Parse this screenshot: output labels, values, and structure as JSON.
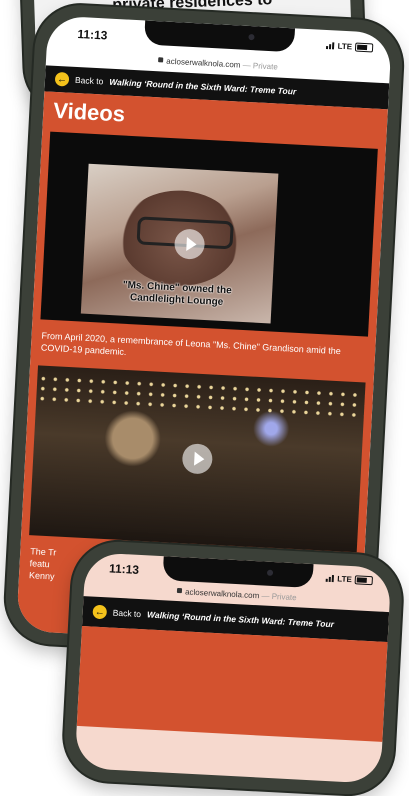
{
  "top_phone": {
    "partial_text": "private residences to",
    "back_chevron": "<"
  },
  "main_phone": {
    "status": {
      "time": "11:13",
      "network": "LTE"
    },
    "url": {
      "domain": "acloserwalknola.com",
      "separator": " — ",
      "private": "Private"
    },
    "back_bar": {
      "prefix": "Back to",
      "title": "Walking ‘Round in the Sixth Ward: Treme Tour"
    },
    "section_title": "Videos",
    "video1": {
      "caption_line1": "\"Ms. Chine\" owned the",
      "caption_line2": "Candlelight Lounge",
      "description": "From April 2020, a remembrance of Leona \"Ms. Chine\" Grandison amid the COVID-19 pandemic."
    },
    "video2": {
      "description_fragment_1": "The Tr",
      "description_fragment_2": "featu",
      "description_fragment_3": "Kenny"
    }
  },
  "bottom_phone": {
    "status": {
      "time": "11:13",
      "network": "LTE"
    },
    "url": {
      "domain": "acloserwalknola.com",
      "separator": " — ",
      "private": "Private"
    },
    "back_bar": {
      "prefix": "Back to",
      "title": "Walking ‘Round in the Sixth Ward: Treme Tour"
    }
  },
  "colors": {
    "page_bg": "#d3522f",
    "bar_bg": "#111111",
    "accent": "#f4c21b",
    "phone_body": "#3b4038"
  }
}
